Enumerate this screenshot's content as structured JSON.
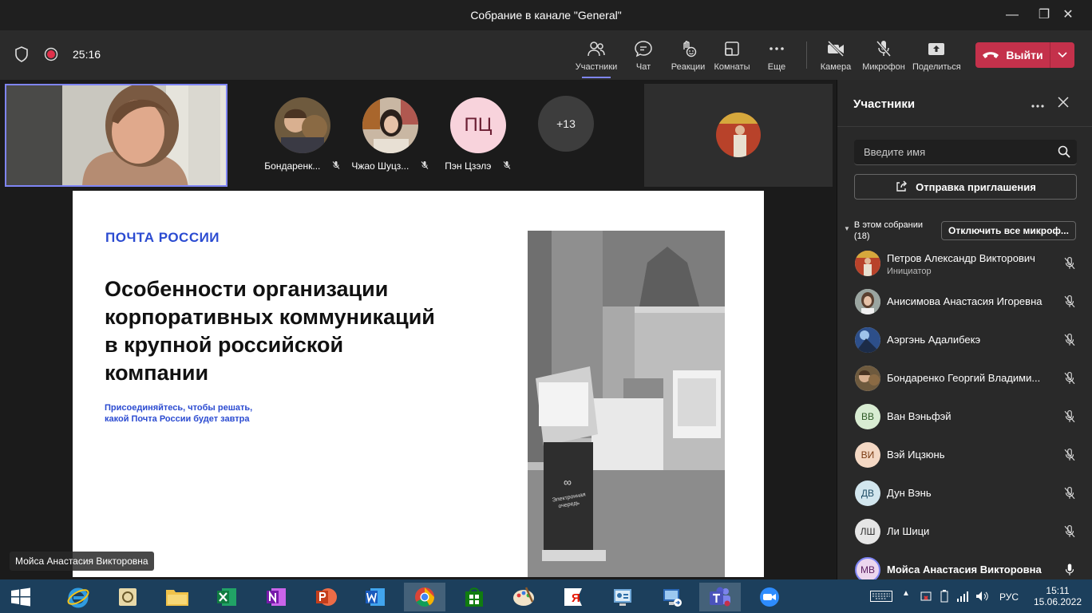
{
  "window": {
    "title": "Собрание в канале \"General\""
  },
  "toolbar": {
    "timer": "25:16",
    "buttons": [
      {
        "label": "Участники",
        "icon": "people-icon"
      },
      {
        "label": "Чат",
        "icon": "chat-icon"
      },
      {
        "label": "Реакции",
        "icon": "reactions-icon"
      },
      {
        "label": "Комнаты",
        "icon": "rooms-icon"
      },
      {
        "label": "Еще",
        "icon": "more-icon"
      },
      {
        "label": "Камера",
        "icon": "camera-off-icon"
      },
      {
        "label": "Микрофон",
        "icon": "mic-off-icon"
      },
      {
        "label": "Поделиться",
        "icon": "share-icon"
      }
    ],
    "leave_label": "Выйти"
  },
  "stage": {
    "avatars": [
      {
        "name": "Бондаренк...",
        "initials": ""
      },
      {
        "name": "Чжао Шуцз...",
        "initials": ""
      },
      {
        "name": "Пэн Цзэлэ",
        "initials": "ПЦ"
      }
    ],
    "overflow": "+13",
    "presenter_name": "Мойса Анастасия Викторовна"
  },
  "slide": {
    "logo": "ПОЧТА РОССИИ",
    "heading_lines": [
      "Особенности организации",
      "корпоративных коммуникаций",
      "в крупной российской",
      "компании"
    ],
    "sub_lines": [
      "Присоединяйтесь, чтобы решать,",
      "какой Почта России будет завтра"
    ],
    "kiosk_text": "Электронная очередь"
  },
  "panel": {
    "title": "Участники",
    "search_placeholder": "Введите имя",
    "invite_label": "Отправка приглашения",
    "section_label": "В этом собрании",
    "section_count": "(18)",
    "mute_all_label": "Отключить все микроф...",
    "participants": [
      {
        "name": "Петров Александр Викторович",
        "role": "Инициатор",
        "initials": "",
        "mic": "muted"
      },
      {
        "name": "Анисимова Анастасия Игоревна",
        "role": "",
        "initials": "",
        "mic": "muted"
      },
      {
        "name": "Аэргэнь Адалибекэ",
        "role": "",
        "initials": "",
        "mic": "muted"
      },
      {
        "name": "Бондаренко Георгий Владими...",
        "role": "",
        "initials": "",
        "mic": "muted"
      },
      {
        "name": "Ван Вэньфэй",
        "role": "",
        "initials": "ВВ",
        "mic": "muted"
      },
      {
        "name": "Вэй Ицзюнь",
        "role": "",
        "initials": "ВИ",
        "mic": "muted"
      },
      {
        "name": "Дун Вэнь",
        "role": "",
        "initials": "ДВ",
        "mic": "muted"
      },
      {
        "name": "Ли Шици",
        "role": "",
        "initials": "ЛШ",
        "mic": "muted"
      },
      {
        "name": "Мойса Анастасия Викторовна",
        "role": "",
        "initials": "МВ",
        "mic": "on"
      }
    ]
  },
  "taskbar": {
    "apps": [
      "start",
      "internet-explorer",
      "paint-sketch",
      "file-explorer",
      "excel",
      "onenote",
      "powerpoint",
      "word",
      "chrome",
      "store",
      "paint",
      "yandex",
      "control-panel",
      "remote-desktop",
      "teams",
      "zoom"
    ],
    "lang": "РУС",
    "time": "15:11",
    "date": "15.06.2022"
  },
  "colors": {
    "accent": "#7f85f5",
    "leave": "#c4314b",
    "brand_blue": "#2b4bd1",
    "taskbar": "#1c3f5c"
  }
}
